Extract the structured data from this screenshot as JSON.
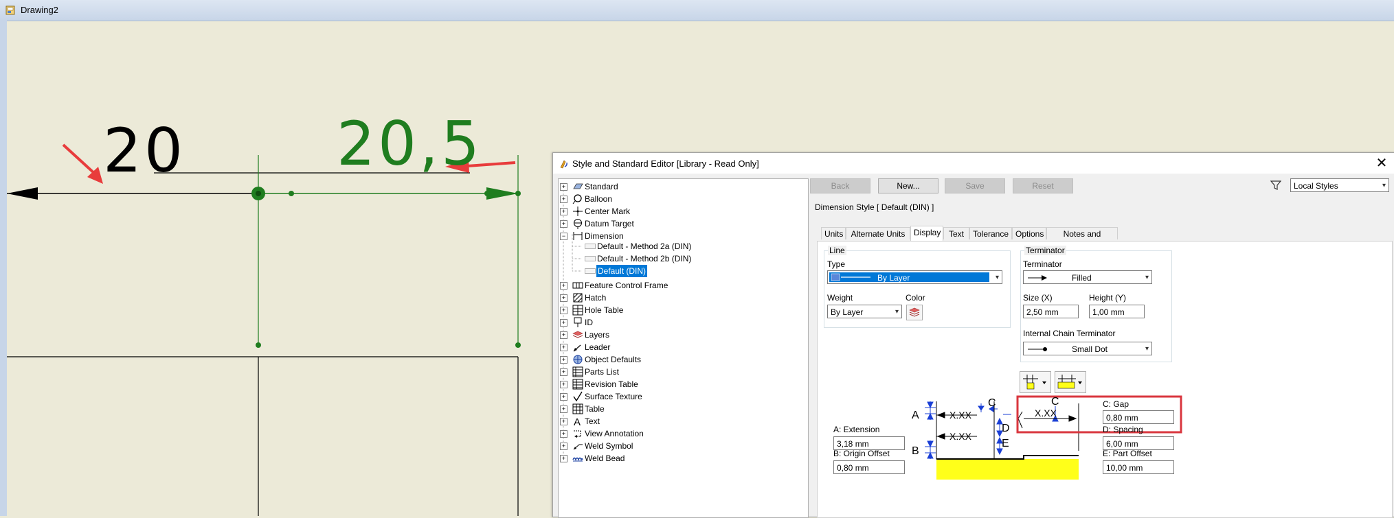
{
  "window": {
    "title": "Drawing2"
  },
  "drawing": {
    "dim_black": "20",
    "dim_green": "20,5",
    "green_color": "#1f7d1f",
    "arrow_color": "#e83c3c"
  },
  "dialog": {
    "title": "Style and Standard Editor [Library - Read Only]",
    "close_glyph": "✕",
    "toolbar": {
      "back": "Back",
      "new": "New...",
      "save": "Save",
      "reset": "Reset"
    },
    "filter": {
      "selected": "Local Styles"
    },
    "style_header": "Dimension Style [ Default (DIN) ]",
    "tabs": [
      "Units",
      "Alternate Units",
      "Display",
      "Text",
      "Tolerance",
      "Options",
      "Notes and Leaders"
    ],
    "active_tab": "Display",
    "tree": [
      {
        "label": "Standard",
        "icon": "standard-icon"
      },
      {
        "label": "Balloon",
        "icon": "balloon-icon"
      },
      {
        "label": "Center Mark",
        "icon": "center-mark-icon"
      },
      {
        "label": "Datum Target",
        "icon": "datum-target-icon"
      },
      {
        "label": "Dimension",
        "icon": "dimension-icon",
        "expanded": true
      },
      {
        "label": "Feature Control Frame",
        "icon": "feature-control-frame-icon"
      },
      {
        "label": "Hatch",
        "icon": "hatch-icon"
      },
      {
        "label": "Hole Table",
        "icon": "hole-table-icon"
      },
      {
        "label": "ID",
        "icon": "id-icon"
      },
      {
        "label": "Layers",
        "icon": "layers-icon"
      },
      {
        "label": "Leader",
        "icon": "leader-icon"
      },
      {
        "label": "Object Defaults",
        "icon": "object-defaults-icon"
      },
      {
        "label": "Parts List",
        "icon": "parts-list-icon"
      },
      {
        "label": "Revision Table",
        "icon": "revision-table-icon"
      },
      {
        "label": "Surface Texture",
        "icon": "surface-texture-icon"
      },
      {
        "label": "Table",
        "icon": "table-icon"
      },
      {
        "label": "Text",
        "icon": "text-icon"
      },
      {
        "label": "View Annotation",
        "icon": "view-annotation-icon"
      },
      {
        "label": "Weld Symbol",
        "icon": "weld-symbol-icon"
      },
      {
        "label": "Weld Bead",
        "icon": "weld-bead-icon"
      }
    ],
    "dimension_children": [
      "Default - Method 2a (DIN)",
      "Default - Method 2b (DIN)",
      "Default (DIN)"
    ],
    "selected_child": "Default (DIN)",
    "display": {
      "line_group": "Line",
      "type_label": "Type",
      "type_value": "By Layer",
      "weight_label": "Weight",
      "weight_value": "By Layer",
      "color_label": "Color",
      "terminator_group": "Terminator",
      "terminator_label": "Terminator",
      "terminator_value": "Filled",
      "size_label": "Size (X)",
      "size_value": "2,50 mm",
      "height_label": "Height (Y)",
      "height_value": "1,00 mm",
      "chain_label": "Internal Chain Terminator",
      "chain_value": "Small Dot",
      "extension_label": "A: Extension",
      "extension_value": "3,18 mm",
      "origin_label": "B: Origin Offset",
      "origin_value": "0,80 mm",
      "gap_label": "C: Gap",
      "gap_value": "0,80 mm",
      "spacing_label": "D: Spacing",
      "spacing_value": "6,00 mm",
      "part_offset_label": "E: Part Offset",
      "part_offset_value": "10,00 mm"
    },
    "diagram": {
      "A": "A",
      "B": "B",
      "C": "C",
      "D": "D",
      "E": "E",
      "xxx": "X.XX",
      "highlight_color": "#d9363e",
      "blue_color": "#1a3fd6",
      "yellow_color": "#ffff1a"
    }
  }
}
